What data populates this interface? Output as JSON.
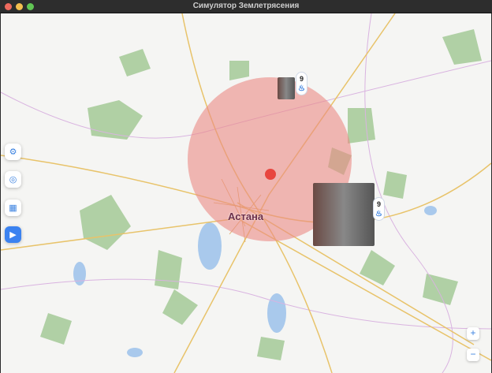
{
  "window": {
    "title": "Симулятор Землетрясения"
  },
  "map": {
    "city_label": "Астана",
    "epicenter_color": "#e8463f",
    "impact_zone_color": "#eb8a85",
    "markers": [
      {
        "value": "9",
        "icon": "flame-icon"
      },
      {
        "value": "9",
        "icon": "flame-icon"
      }
    ]
  },
  "sidebar": {
    "buttons": [
      {
        "name": "settings",
        "icon": "gear-icon",
        "glyph": "⚙"
      },
      {
        "name": "radius",
        "icon": "radar-icon",
        "glyph": "◎"
      },
      {
        "name": "report",
        "icon": "chart-icon",
        "glyph": "▦"
      },
      {
        "name": "play",
        "icon": "play-icon",
        "glyph": "▶"
      }
    ]
  },
  "zoom": {
    "in": "+",
    "out": "−"
  }
}
